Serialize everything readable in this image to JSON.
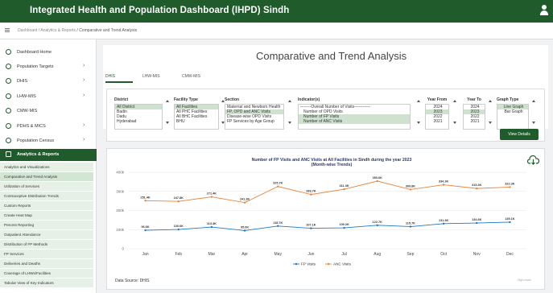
{
  "header": {
    "title": "Integrated Health and Population Dashboard (IHPD) Sindh"
  },
  "breadcrumb": {
    "home": "Dashboard",
    "sep1": " / ",
    "parent": "Analytics & Reports",
    "sep2": " / ",
    "current": "Comparative and Trend Analysis"
  },
  "sidebar": {
    "items": [
      {
        "label": "Dashboard Home",
        "chevron": ""
      },
      {
        "label": "Population Targets",
        "chevron": "›"
      },
      {
        "label": "DHIS",
        "chevron": "›"
      },
      {
        "label": "LHW-MIS",
        "chevron": "›"
      },
      {
        "label": "CMW-MIS",
        "chevron": ""
      },
      {
        "label": "PDHS & MICS",
        "chevron": "›"
      },
      {
        "label": "Population Census",
        "chevron": "›"
      },
      {
        "label": "Analytics & Reports",
        "chevron": ""
      }
    ],
    "subitems": [
      "Analytics and Visualizations",
      "Comparative and Trend Analysis",
      "Utilization of Services",
      "Contraceptive Distribution Trends",
      "Custom Reports",
      "Create Heat Map",
      "Percent Reporting",
      "Outpatient Attendance",
      "Distribution of FP Methods",
      "FP Services",
      "Deliveries and Deaths",
      "Coverage of LHWs/Facilities",
      "Tabular View of Key Indicators"
    ]
  },
  "main": {
    "title": "Comparative and Trend Analysis",
    "tabs": [
      "DHIS",
      "LHW-MIS",
      "CMW-MIS"
    ]
  },
  "filters": {
    "district": {
      "label": "District",
      "options": [
        "All District",
        "Badin",
        "Dadu",
        "Hyderabad"
      ]
    },
    "facility_type": {
      "label": "Facility Type",
      "options": [
        "All Facilities",
        "All PHC Facilities",
        "All BHC Facilities",
        "BHU"
      ]
    },
    "section": {
      "label": "Section",
      "options": [
        "Maternal and Newborn Health",
        "FP, OPD and ANC Visits",
        "Disease-wise OPD Visits",
        "FP Services by Age Group"
      ]
    },
    "indicator": {
      "label": "Indicator(s)",
      "options": [
        "--------Overall Number of Visits------------",
        "Number of OPD Visits",
        "Number of FP Visits",
        "Number of ANC Visits"
      ]
    },
    "year_from": {
      "label": "Year From",
      "options": [
        "2024",
        "2023",
        "2022",
        "2021"
      ]
    },
    "year_to": {
      "label": "Year To",
      "options": [
        "2024",
        "2023",
        "2022",
        "2021"
      ]
    },
    "graph_type": {
      "label": "Graph Type",
      "options": [
        "Line Graph",
        "Bar Graph"
      ]
    },
    "view_button": "View Details"
  },
  "chart_data": {
    "type": "line",
    "title": "Number of FP Visits and ANC Visits at All Facilities in Sindh during the year 2023",
    "subtitle": "(Month-wise Trends)",
    "categories": [
      "Jan",
      "Feb",
      "Mar",
      "Apr",
      "May",
      "Jun",
      "Jul",
      "Aug",
      "Sep",
      "Oct",
      "Nov",
      "Dec"
    ],
    "series": [
      {
        "name": "FP Visits",
        "color": "#1f77c4",
        "values": [
          96.6,
          100.6,
          113.3,
          95.0,
          118.7,
          107.1,
          109.2,
          122.7,
          115.7,
          131.3,
          134.6,
          139.1
        ],
        "labels": [
          "96.6K",
          "100.6K",
          "113.3K",
          "95.0K",
          "118.7K",
          "107.1K",
          "109.2K",
          "122.7K",
          "115.7K",
          "131.3K",
          "134.6K",
          "139.1K"
        ]
      },
      {
        "name": "ANC Visits",
        "color": "#e8843a",
        "values": [
          251.4,
          247.8,
          271.4,
          241.3,
          325.7,
          283.7,
          311.3,
          353.6,
          309.8,
          334.3,
          315.3,
          322.3
        ],
        "labels": [
          "251.4K",
          "247.8K",
          "271.4K",
          "241.3K",
          "325.7K",
          "283.7K",
          "311.3K",
          "353.6K",
          "309.8K",
          "334.3K",
          "315.3K",
          "322.3K"
        ]
      }
    ],
    "yticks": [
      "0",
      "100k",
      "200k",
      "300k",
      "400k"
    ],
    "ylim": [
      0,
      400
    ],
    "legend": "bottom-center"
  },
  "footer": {
    "source": "Data Source: DHIS",
    "credit": "Highcharts"
  },
  "colors": {
    "brand": "#1f5b2b",
    "fp": "#1f77c4",
    "anc": "#e8843a"
  }
}
